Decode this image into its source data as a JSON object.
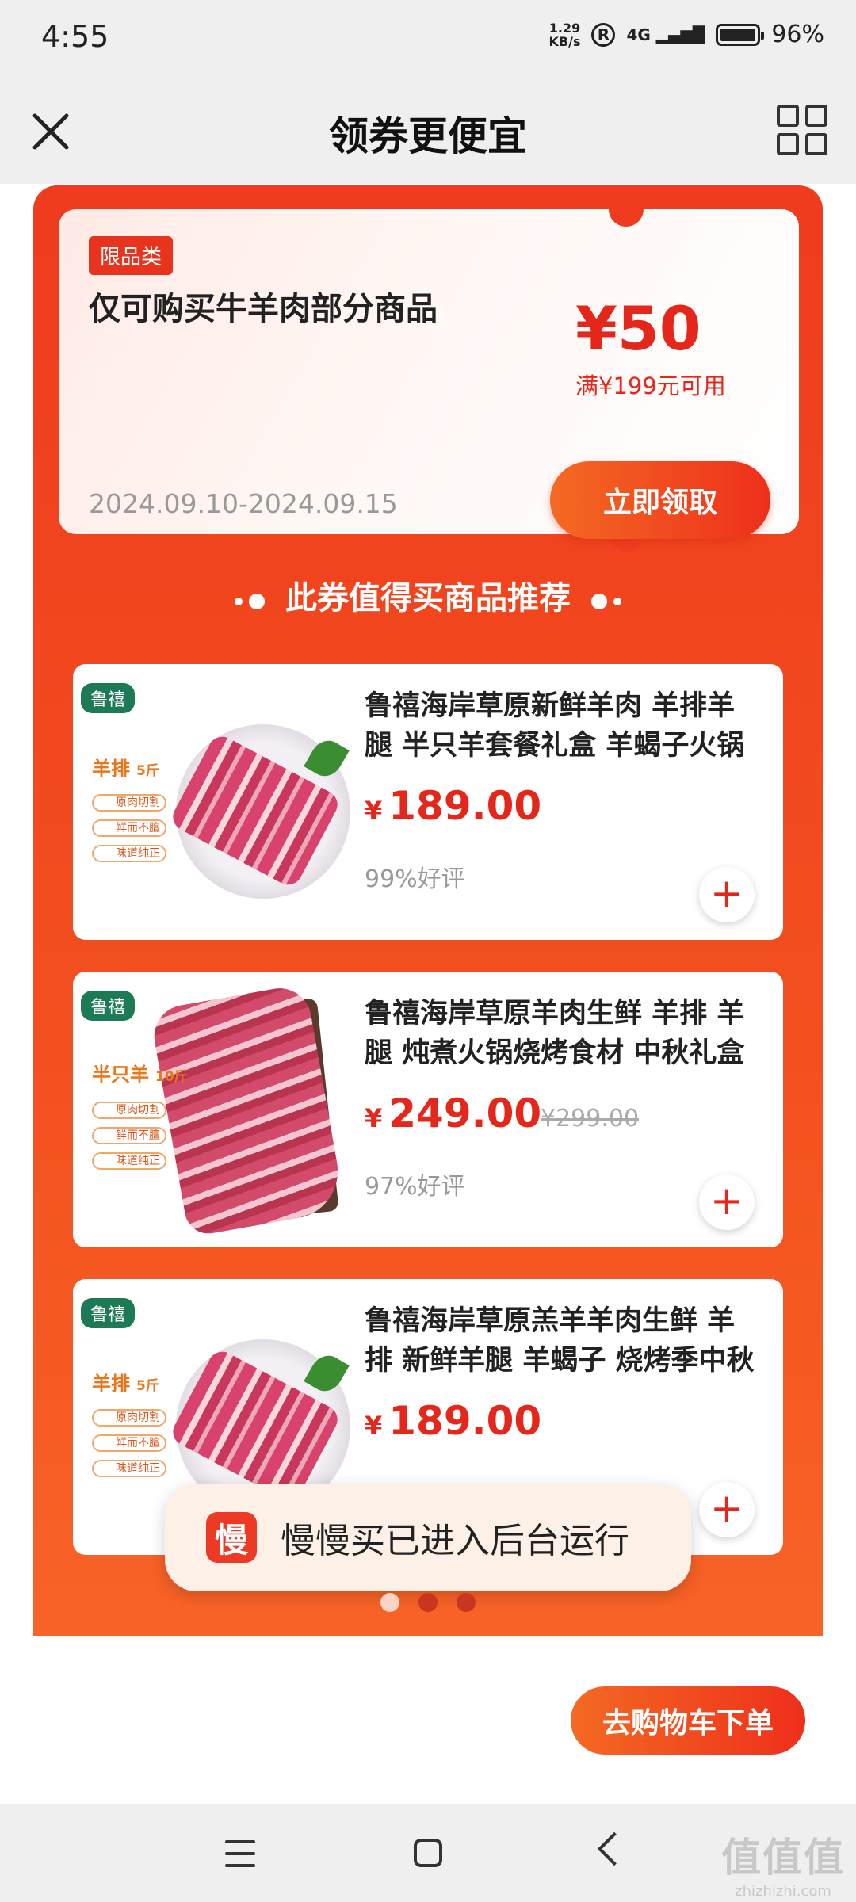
{
  "status": {
    "time": "4:55",
    "netspeed_value": "1.29",
    "netspeed_unit": "KB/s",
    "r_badge": "R",
    "signal": "4G",
    "battery": "96%"
  },
  "header": {
    "title": "领券更便宜",
    "close_icon": "close-icon",
    "menu_icon": "grid-menu-icon"
  },
  "coupon": {
    "tag": "限品类",
    "description": "仅可购买牛羊肉部分商品",
    "amount": "¥50",
    "condition": "满¥199元可用",
    "validity": "2024.09.10-2024.09.15",
    "claim_label": "立即领取"
  },
  "recommend_title": "此券值得买商品推荐",
  "products": [
    {
      "brand": "鲁禧",
      "label": "羊排",
      "label_unit": "5斤",
      "features": [
        "原肉切割",
        "鲜而不膻",
        "味道纯正"
      ],
      "name": "鲁禧海岸草原新鲜羊肉 羊排羊腿 半只羊套餐礼盒 羊蝎子火锅",
      "currency": "¥",
      "price": "189.00",
      "old_price": "",
      "rating": "99%好评"
    },
    {
      "brand": "鲁禧",
      "label": "半只羊",
      "label_unit": "10斤",
      "features": [
        "原肉切割",
        "鲜而不膻",
        "味道纯正"
      ],
      "name": "鲁禧海岸草原羊肉生鲜 羊排 羊腿 炖煮火锅烧烤食材 中秋礼盒",
      "currency": "¥",
      "price": "249.00",
      "old_price": "¥299.00",
      "rating": "97%好评"
    },
    {
      "brand": "鲁禧",
      "label": "羊排",
      "label_unit": "5斤",
      "features": [
        "原肉切割",
        "鲜而不膻",
        "味道纯正"
      ],
      "name": "鲁禧海岸草原羔羊羊肉生鲜 羊排 新鲜羊腿 羊蝎子 烧烤季中秋",
      "currency": "¥",
      "price": "189.00",
      "old_price": "",
      "rating": ""
    }
  ],
  "toast": {
    "icon_char": "慢",
    "message": "慢慢买已进入后台运行"
  },
  "pager": {
    "pages": 3,
    "active": 1
  },
  "checkout_label": "去购物车下单",
  "navbar": {
    "icons": [
      "menu-icon",
      "home-icon",
      "back-icon"
    ]
  },
  "watermark": {
    "big": "值值值",
    "small": "zhizhizhi.com"
  },
  "colors": {
    "accent": "#e5261a",
    "panel": "#ef3b1e",
    "brand_green": "#1c7a55"
  }
}
